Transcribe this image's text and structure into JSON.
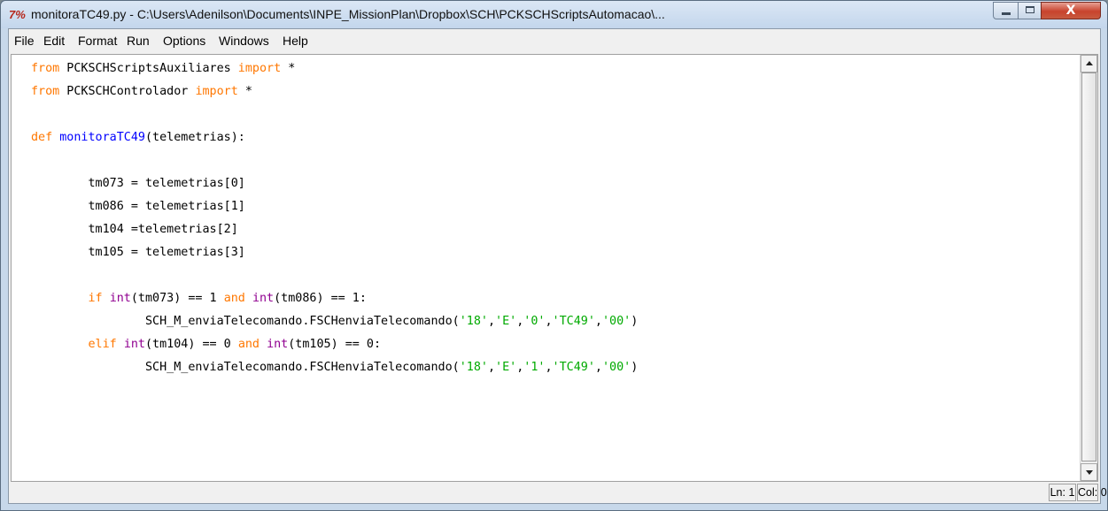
{
  "window": {
    "title": "monitoraTC49.py - C:\\Users\\Adenilson\\Documents\\INPE_MissionPlan\\Dropbox\\SCH\\PCKSCHScriptsAutomacao\\...",
    "app_icon": "7%",
    "controls": {
      "minimize": "minimize-icon",
      "maximize": "maximize-icon",
      "close_glyph": "X"
    }
  },
  "menubar": {
    "items": [
      "File",
      "Edit",
      "Format",
      "Run",
      "Options",
      "Windows",
      "Help"
    ]
  },
  "editor": {
    "colors": {
      "keyword": "#ff7700",
      "builtin": "#900090",
      "definition": "#0000ff",
      "string": "#00aa00"
    },
    "lines": [
      {
        "kw": "from",
        "rest": " PCKSCHScriptsAuxiliares ",
        "kw2": "import",
        "tail": " *"
      },
      {
        "kw": "from",
        "rest": " PCKSCHControlador ",
        "kw2": "import",
        "tail": " *"
      },
      {
        "blank": true
      },
      {
        "kw": "def",
        "fn": "monitoraTC49",
        "tail": "(telemetrias):"
      },
      {
        "blank": true
      },
      {
        "text": "        tm073 = telemetrias[0]"
      },
      {
        "text": "        tm086 = telemetrias[1]"
      },
      {
        "text": "        tm104 =telemetrias[2]"
      },
      {
        "text": "        tm105 = telemetrias[3]"
      },
      {
        "blank": true
      },
      {
        "indent": "        ",
        "kw": "if",
        "b1": "int",
        "p1": "(tm073) == 1 ",
        "kw2": "and",
        "b2": "int",
        "p2": "(tm086) == 1:"
      },
      {
        "indent": "                ",
        "call": "SCH_M_enviaTelecomando.FSCHenviaTelecomando(",
        "args": [
          "'18'",
          "'E'",
          "'0'",
          "'TC49'",
          "'00'"
        ],
        "close": ")"
      },
      {
        "indent": "        ",
        "kw": "elif",
        "b1": "int",
        "p1": "(tm104) == 0 ",
        "kw2": "and",
        "b2": "int",
        "p2": "(tm105) == 0:"
      },
      {
        "indent": "                ",
        "call": "SCH_M_enviaTelecomando.FSCHenviaTelecomando(",
        "args": [
          "'18'",
          "'E'",
          "'1'",
          "'TC49'",
          "'00'"
        ],
        "close": ")"
      }
    ]
  },
  "statusbar": {
    "line": "Ln: 1",
    "col": "Col: 0"
  }
}
